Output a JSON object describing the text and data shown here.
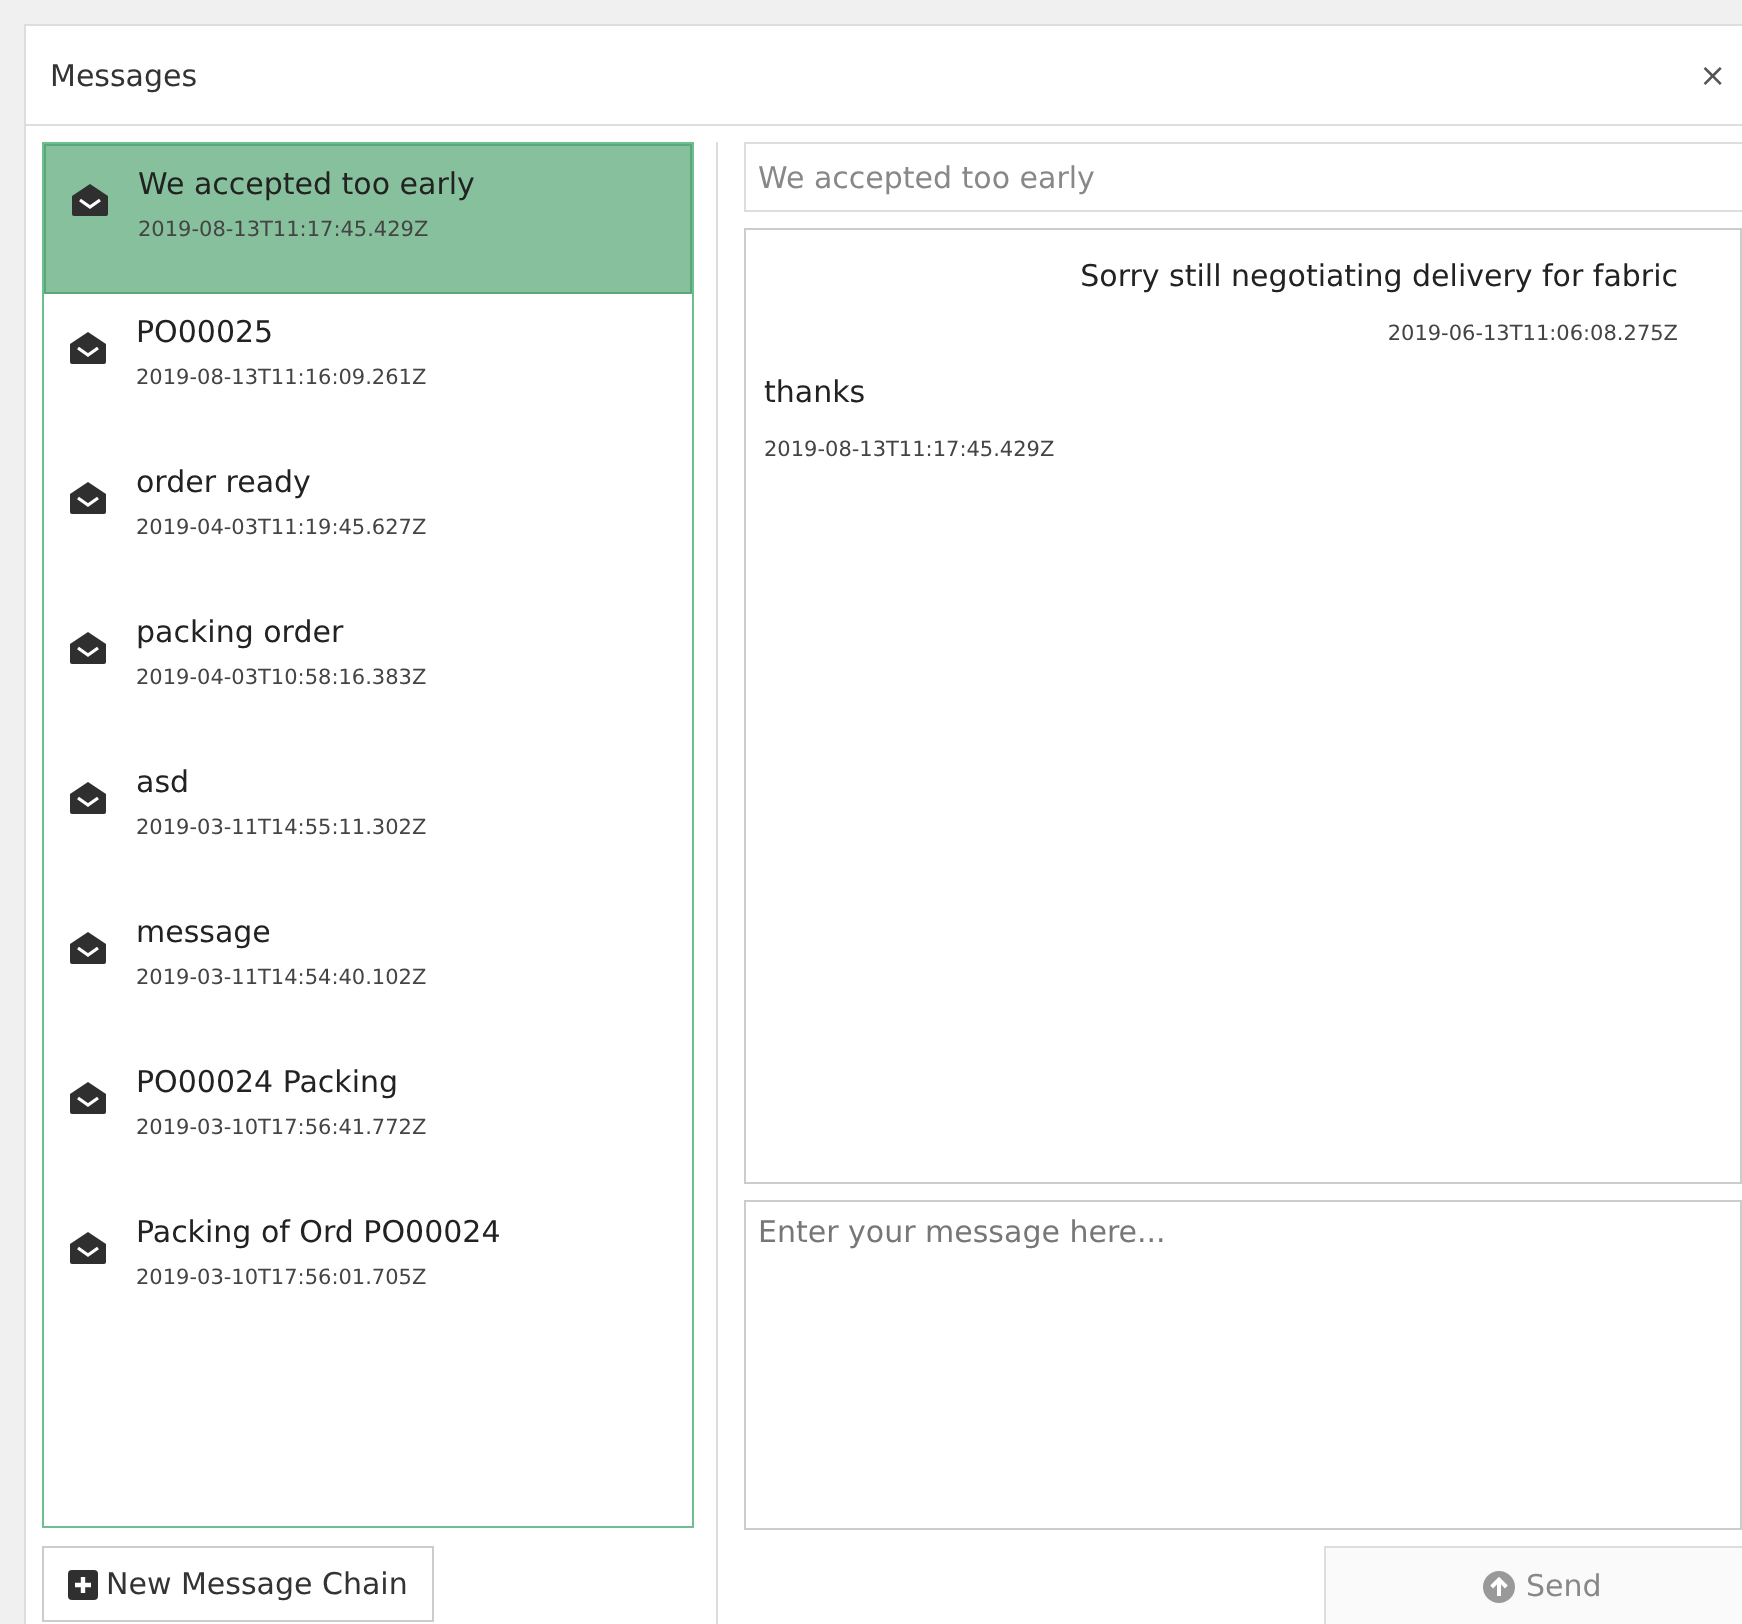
{
  "dialog": {
    "title": "Messages",
    "close": "×"
  },
  "chains": [
    {
      "subject": "We accepted too early",
      "time": "2019-08-13T11:17:45.429Z",
      "selected": true
    },
    {
      "subject": "PO00025",
      "time": "2019-08-13T11:16:09.261Z",
      "selected": false
    },
    {
      "subject": "order ready",
      "time": "2019-04-03T11:19:45.627Z",
      "selected": false
    },
    {
      "subject": "packing order",
      "time": "2019-04-03T10:58:16.383Z",
      "selected": false
    },
    {
      "subject": "asd",
      "time": "2019-03-11T14:55:11.302Z",
      "selected": false
    },
    {
      "subject": "message",
      "time": "2019-03-11T14:54:40.102Z",
      "selected": false
    },
    {
      "subject": "PO00024 Packing",
      "time": "2019-03-10T17:56:41.772Z",
      "selected": false
    },
    {
      "subject": "Packing of Ord PO00024",
      "time": "2019-03-10T17:56:01.705Z",
      "selected": false
    }
  ],
  "new_chain_button": "New Message Chain",
  "subject_field": {
    "value": "We accepted too early"
  },
  "messages": [
    {
      "kind": "sent",
      "text": "Sorry still negotiating delivery for fabric",
      "time": "2019-06-13T11:06:08.275Z"
    },
    {
      "kind": "received",
      "text": "thanks",
      "time": "2019-08-13T11:17:45.429Z"
    }
  ],
  "compose": {
    "placeholder": "Enter your message here..."
  },
  "send_button": {
    "label": "Send",
    "disabled": true
  }
}
